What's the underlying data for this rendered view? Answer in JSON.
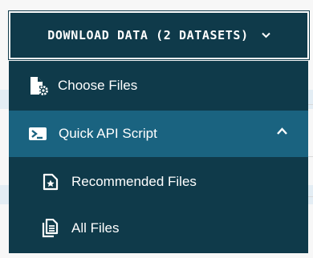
{
  "download_button": {
    "label": "DOWNLOAD DATA (2 DATASETS)",
    "icon": "chevron-down-icon"
  },
  "menu": {
    "items": [
      {
        "label": "Choose Files",
        "icon": "file-settings-icon"
      },
      {
        "label": "Quick API Script",
        "icon": "terminal-icon",
        "expanded": true,
        "toggle_icon": "chevron-up-icon"
      },
      {
        "label": "Recommended Files",
        "icon": "file-star-icon"
      },
      {
        "label": "All Files",
        "icon": "files-icon"
      }
    ]
  },
  "colors": {
    "menu_background": "#0f3a4a",
    "active_item": "#1a6380",
    "text": "#ffffff"
  }
}
